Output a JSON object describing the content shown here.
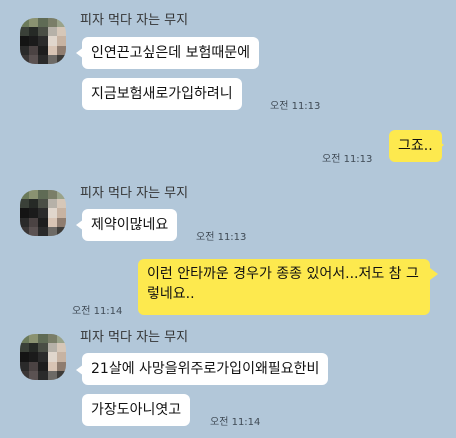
{
  "colors": {
    "background": "#b2c7d9",
    "incoming_bubble": "#ffffff",
    "outgoing_bubble": "#fde94e",
    "timestamp": "#3f4a55"
  },
  "avatar_mosaic": [
    "#6b7a5a",
    "#8a9271",
    "#5f6b55",
    "#7a7e68",
    "#9aa38a",
    "#3a4038",
    "#262a26",
    "#4a4e45",
    "#b6b1a8",
    "#d6c7b8",
    "#141414",
    "#1b1b1b",
    "#2b2b2b",
    "#e0d6cc",
    "#c7b3a2",
    "#2a2a2a",
    "#4b4343",
    "#1d1d1d",
    "#d8c4b4",
    "#8f7d70",
    "#3b3737",
    "#5b5252",
    "#2a2a2a",
    "#6d6a66",
    "#3d3b38"
  ],
  "groups": [
    {
      "sender": "피자 먹다 자는 무지",
      "messages": [
        {
          "text": "인연끈고싶은데 보험때문에",
          "time": ""
        },
        {
          "text": "지금보험새로가입하려니",
          "time": "오전 11:13"
        }
      ]
    },
    {
      "outgoing": {
        "text": "그죠..",
        "time": "오전 11:13"
      }
    },
    {
      "sender": "피자 먹다 자는 무지",
      "messages": [
        {
          "text": "제약이많네요",
          "time": "오전 11:13"
        }
      ]
    },
    {
      "outgoing": {
        "text": "이런 안타까운 경우가 종종 있어서...저도 참 그렇네요..",
        "time": "오전 11:14"
      }
    },
    {
      "sender": "피자 먹다 자는 무지",
      "messages": [
        {
          "text": "21살에 사망을위주로가입이왜필요한비",
          "time": ""
        },
        {
          "text": "가장도아니엿고",
          "time": "오전 11:14"
        }
      ]
    }
  ]
}
